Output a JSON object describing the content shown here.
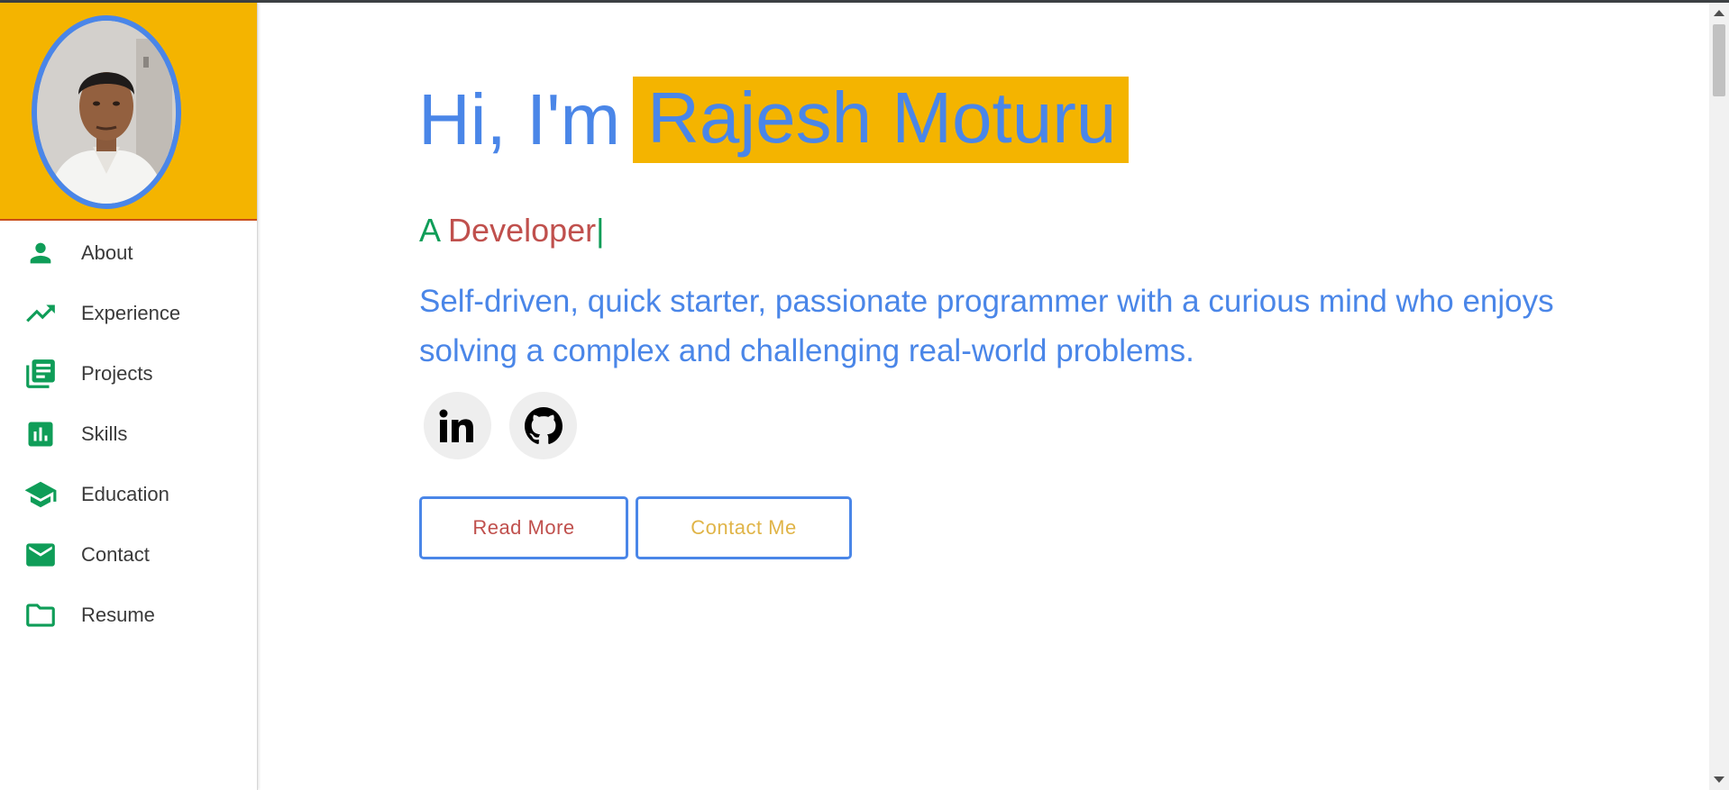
{
  "hero": {
    "greeting": "Hi, I'm",
    "name": "Rajesh Moturu",
    "role_prefix": "A",
    "role_word": "Developer",
    "caret": "|",
    "bio": "Self-driven, quick starter, passionate programmer with a curious mind who enjoys solving a complex and challenging real-world problems."
  },
  "sidebar": {
    "items": [
      {
        "label": "About",
        "icon": "person-icon"
      },
      {
        "label": "Experience",
        "icon": "trending-up-icon"
      },
      {
        "label": "Projects",
        "icon": "library-books-icon"
      },
      {
        "label": "Skills",
        "icon": "bar-chart-icon"
      },
      {
        "label": "Education",
        "icon": "graduation-cap-icon"
      },
      {
        "label": "Contact",
        "icon": "mail-icon"
      },
      {
        "label": "Resume",
        "icon": "folder-icon"
      }
    ]
  },
  "social": [
    "linkedin-icon",
    "github-icon"
  ],
  "buttons": {
    "read_more": "Read More",
    "contact_me": "Contact Me"
  },
  "colors": {
    "accent_yellow": "#f4b400",
    "primary_blue": "#4a86e8",
    "green": "#0f9d58",
    "red": "#c0504d",
    "gold": "#e0b447"
  }
}
